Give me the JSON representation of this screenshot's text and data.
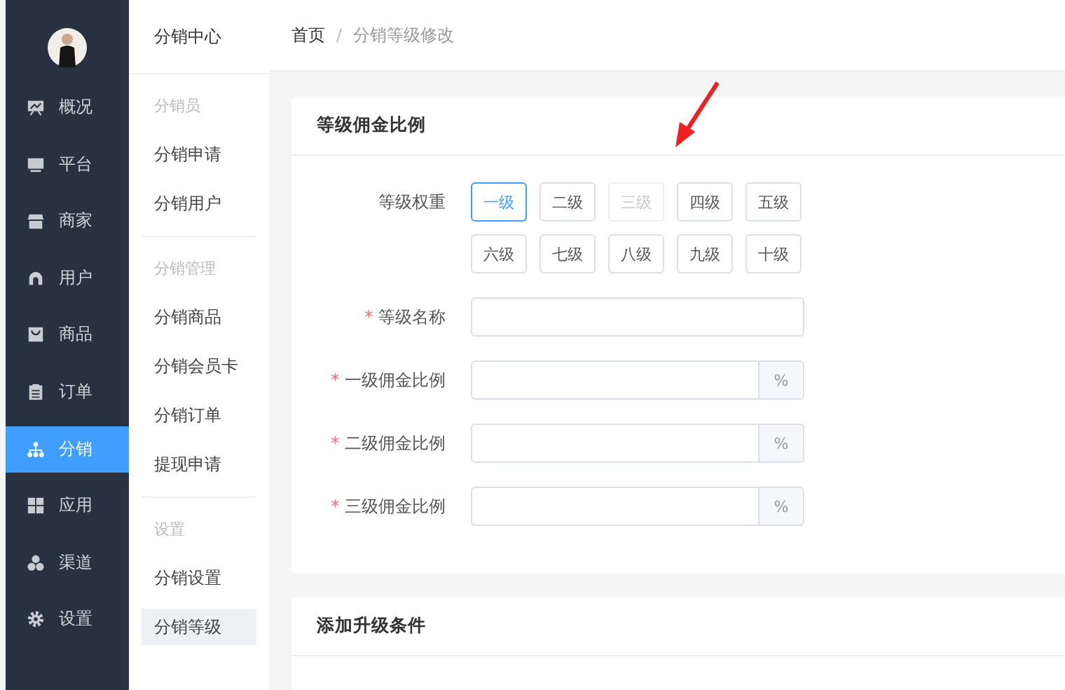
{
  "sidebar": {
    "items": [
      {
        "label": "概况",
        "selected": false
      },
      {
        "label": "平台",
        "selected": false
      },
      {
        "label": "商家",
        "selected": false
      },
      {
        "label": "用户",
        "selected": false
      },
      {
        "label": "商品",
        "selected": false
      },
      {
        "label": "订单",
        "selected": false
      },
      {
        "label": "分销",
        "selected": true
      },
      {
        "label": "应用",
        "selected": false
      },
      {
        "label": "渠道",
        "selected": false
      },
      {
        "label": "设置",
        "selected": false
      }
    ]
  },
  "submenu": {
    "title": "分销中心",
    "groups": [
      {
        "title": "分销员",
        "items": [
          {
            "label": "分销申请",
            "selected": false
          },
          {
            "label": "分销用户",
            "selected": false
          }
        ]
      },
      {
        "title": "分销管理",
        "items": [
          {
            "label": "分销商品",
            "selected": false
          },
          {
            "label": "分销会员卡",
            "selected": false
          },
          {
            "label": "分销订单",
            "selected": false
          },
          {
            "label": "提现申请",
            "selected": false
          }
        ]
      },
      {
        "title": "设置",
        "items": [
          {
            "label": "分销设置",
            "selected": false
          },
          {
            "label": "分销等级",
            "selected": true
          }
        ]
      }
    ]
  },
  "breadcrumb": [
    "首页",
    "/",
    "分销等级修改"
  ],
  "cards": [
    {
      "title": "等级佣金比例",
      "rows": [
        {
          "kind": "levels",
          "label": "等级权重",
          "options": [
            {
              "label": "一级",
              "selected": true,
              "disabled": false
            },
            {
              "label": "二级",
              "selected": false,
              "disabled": false
            },
            {
              "label": "三级",
              "selected": false,
              "disabled": true
            },
            {
              "label": "四级",
              "selected": false,
              "disabled": false
            },
            {
              "label": "五级",
              "selected": false,
              "disabled": false
            },
            {
              "label": "六级",
              "selected": false,
              "disabled": false
            },
            {
              "label": "七级",
              "selected": false,
              "disabled": false
            },
            {
              "label": "八级",
              "selected": false,
              "disabled": false
            },
            {
              "label": "九级",
              "selected": false,
              "disabled": false
            },
            {
              "label": "十级",
              "selected": false,
              "disabled": false
            }
          ]
        },
        {
          "kind": "text",
          "label": "等级名称",
          "required_mark": "*"
        },
        {
          "kind": "percent",
          "label": "一级佣金比例",
          "required_mark": "*",
          "suffix": "%"
        },
        {
          "kind": "percent",
          "label": "二级佣金比例",
          "required_mark": "*",
          "suffix": "%"
        },
        {
          "kind": "percent",
          "label": "三级佣金比例",
          "required_mark": "*",
          "suffix": "%"
        }
      ]
    },
    {
      "title": "添加升级条件"
    }
  ]
}
